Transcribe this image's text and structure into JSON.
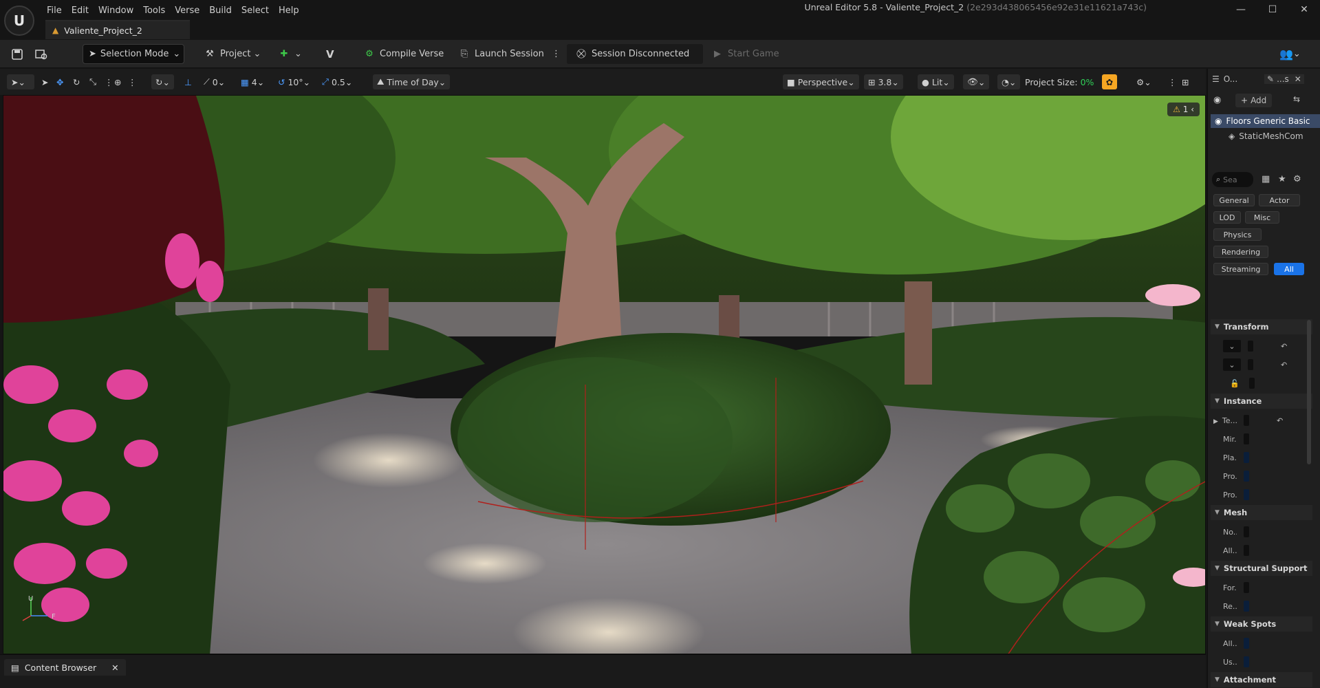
{
  "menu": [
    "File",
    "Edit",
    "Window",
    "Tools",
    "Verse",
    "Build",
    "Select",
    "Help"
  ],
  "window": {
    "title": "Unreal Editor 5.8 - Valiente_Project_2",
    "hash": "(2e293d438065456e92e31e11621a743c)",
    "minimize": "—",
    "maximize": "☐",
    "close": "✕"
  },
  "tab": {
    "label": "Valiente_Project_2"
  },
  "toolbar": {
    "selection_mode": "Selection Mode",
    "project": "Project",
    "compile_verse": "Compile Verse",
    "launch_session": "Launch Session",
    "session_status": "Session Disconnected",
    "start_game": "Start Game"
  },
  "viewport_toolbar": {
    "rotation_snap": "0",
    "grid_snap": "4",
    "angle_snap": "10°",
    "scale_snap": "0.5",
    "time_of_day": "Time of Day",
    "perspective": "Perspective",
    "camera_speed": "3.8",
    "view_mode": "Lit",
    "project_size_label": "Project Size:",
    "project_size_value": "0%"
  },
  "viewport": {
    "warning_count": "1",
    "axis_x": "F",
    "axis_z": "U"
  },
  "content_browser": {
    "tab_label": "Content Browser"
  },
  "right_panel": {
    "outliner_short": "O...",
    "details_short": "...s",
    "add_label": "Add",
    "actor_name": "Floors Generic Basic",
    "component_name": "StaticMeshCom",
    "search_placeholder": "Sea",
    "filters": [
      "General",
      "Actor",
      "LOD",
      "Misc",
      "Physics",
      "Rendering",
      "Streaming",
      "All"
    ],
    "sections": [
      {
        "title": "Transform",
        "props": []
      },
      {
        "title": "Instance",
        "props": [
          "Te...",
          "Mir...",
          "Pla...",
          "Pro...",
          "Pro..."
        ]
      },
      {
        "title": "Mesh",
        "props": [
          "No...",
          "All..."
        ]
      },
      {
        "title": "Structural Support",
        "props": [
          "For...",
          "Re..."
        ]
      },
      {
        "title": "Weak Spots",
        "props": [
          "All...",
          "Us..."
        ]
      },
      {
        "title": "Attachment",
        "props": []
      }
    ]
  },
  "colors": {
    "accent": "#1a73e8",
    "project_size": "#30d158",
    "warning": "#f0b83a",
    "quick_settings": "#f5a623"
  }
}
